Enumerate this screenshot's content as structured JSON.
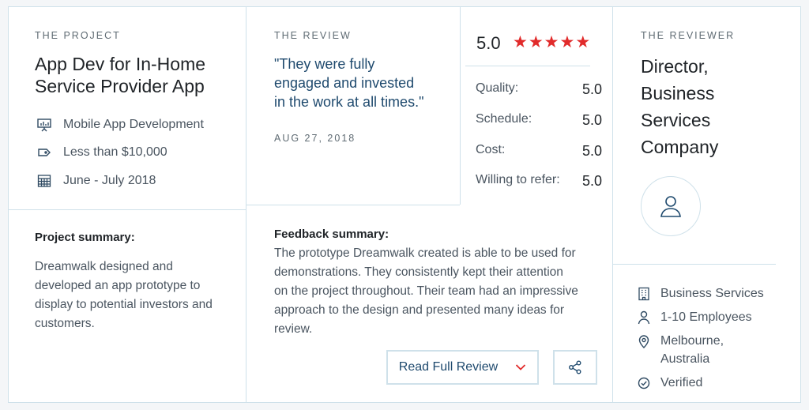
{
  "project": {
    "eyebrow": "THE PROJECT",
    "title_line1": "App Dev for In-Home",
    "title_line2": "Service Provider App",
    "meta": [
      {
        "icon": "presentation-icon",
        "text": "Mobile App Development"
      },
      {
        "icon": "price-tag-icon",
        "text": "Less than $10,000"
      },
      {
        "icon": "calendar-icon",
        "text": "June - July 2018"
      }
    ],
    "summary_label": "Project summary:",
    "summary_lines": [
      "Dreamwalk designed and",
      "developed an app prototype to",
      "display to potential investors and",
      "customers."
    ]
  },
  "review": {
    "eyebrow": "THE REVIEW",
    "quote_lines": [
      "\"They were fully",
      "engaged and invested",
      "in the work at all times.\""
    ],
    "date": "AUG 27, 2018",
    "overall_score": "5.0",
    "stars": 5,
    "ratings": [
      {
        "label": "Quality:",
        "value": "5.0"
      },
      {
        "label": "Schedule:",
        "value": "5.0"
      },
      {
        "label": "Cost:",
        "value": "5.0"
      },
      {
        "label": "Willing to refer:",
        "value": "5.0"
      }
    ],
    "feedback_label": "Feedback summary:",
    "feedback_lines": [
      "The prototype Dreamwalk created is able to be used for",
      "demonstrations. They consistently kept their attention",
      "on the project throughout. Their team had an impressive",
      "approach to the design and presented many ideas for",
      "review."
    ],
    "read_full_review": "Read Full Review"
  },
  "reviewer": {
    "eyebrow": "THE REVIEWER",
    "title_lines": [
      "Director,",
      "Business",
      "Services",
      "Company"
    ],
    "industry": "Business Services",
    "employees": "1-10 Employees",
    "location_line1": "Melbourne,",
    "location_line2": "Australia",
    "verified": "Verified"
  },
  "colors": {
    "star": "#e12b2b",
    "accent_text": "#1f4a6e",
    "border": "#cfe1ea"
  }
}
